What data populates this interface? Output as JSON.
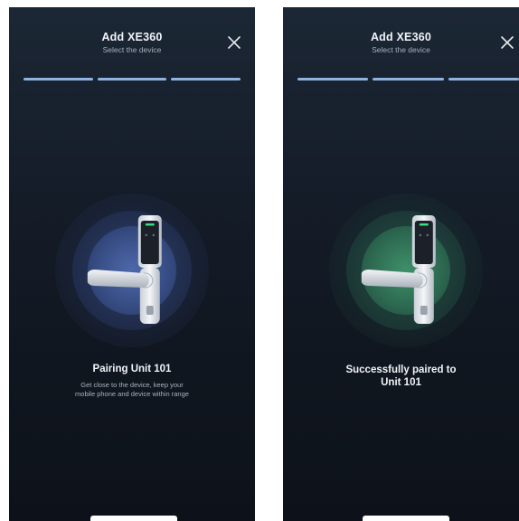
{
  "screens": [
    {
      "header": {
        "title": "Add XE360",
        "subtitle": "Select the device"
      },
      "close_icon": "close-icon",
      "progress": {
        "segments": 3,
        "completed": 3
      },
      "status": {
        "title": "Pairing Unit 101",
        "description_line1": "Get close to the device, keep your",
        "description_line2": "mobile phone and device within range"
      },
      "glow_color": "#5f7dcd"
    },
    {
      "header": {
        "title": "Add XE360",
        "subtitle": "Select the device"
      },
      "close_icon": "close-icon",
      "progress": {
        "segments": 3,
        "completed": 3
      },
      "status": {
        "title_line1": "Successfully paired to",
        "title_line2": "Unit 101"
      },
      "glow_color": "#50b982"
    }
  ],
  "colors": {
    "progress": "#8fb4e2",
    "background": "#141c28",
    "led": "#3ddc84"
  }
}
